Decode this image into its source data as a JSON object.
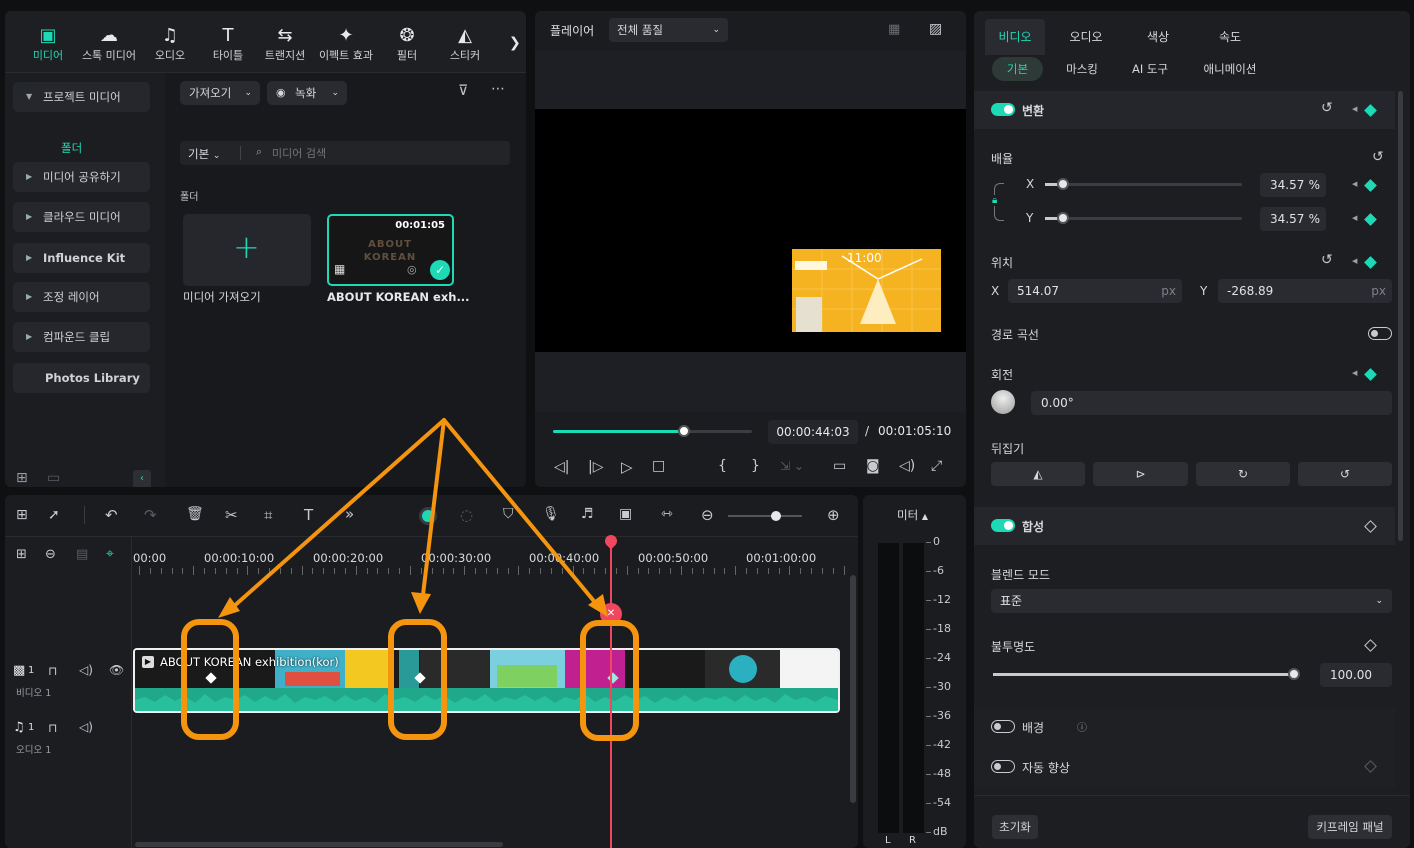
{
  "media_panel": {
    "tabs": [
      {
        "label": "미디어",
        "icon": "media-icon"
      },
      {
        "label": "스톡 미디어",
        "icon": "cloud-icon"
      },
      {
        "label": "오디오",
        "icon": "music-note-icon"
      },
      {
        "label": "타이틀",
        "icon": "text-t-icon"
      },
      {
        "label": "트랜지션",
        "icon": "transition-icon"
      },
      {
        "label": "이펙트 효과",
        "icon": "sparkle-icon"
      },
      {
        "label": "필터",
        "icon": "filter-icon"
      },
      {
        "label": "스티커",
        "icon": "sticker-icon"
      }
    ],
    "more_tabs": "❯",
    "sidebar": {
      "project_media": "프로젝트 미디어",
      "folder": "폴더",
      "items": [
        "미디어 공유하기",
        "클라우드 미디어",
        "Influence Kit",
        "조정 레이어",
        "컴파운드 클립"
      ],
      "photos_library": "Photos Library"
    },
    "import_dropdown": "가져오기",
    "record_dropdown": "녹화",
    "view_dropdown": "기본",
    "search_placeholder": "미디어 검색",
    "folder_heading": "폴더",
    "import_tile_label": "미디어 가져오기",
    "clip": {
      "duration": "00:01:05",
      "name": "ABOUT KOREAN exh...",
      "thumb_text": "ABOUT KOREAN"
    }
  },
  "player": {
    "label": "플레이어",
    "quality": "전체 품질",
    "current_time": "00:00:44:03",
    "separator": "/",
    "total_time": "00:01:05:10",
    "progress": 0.66,
    "preview_text": "11:00"
  },
  "properties": {
    "tabs": [
      "비디오",
      "오디오",
      "색상",
      "속도"
    ],
    "subtabs": [
      "기본",
      "마스킹",
      "AI 도구",
      "애니메이션"
    ],
    "transform": "변환",
    "scale": {
      "label": "배율",
      "x_label": "X",
      "y_label": "Y",
      "x": "34.57",
      "y": "34.57",
      "unit": "%",
      "level": 0.09
    },
    "position": {
      "label": "위치",
      "x_label": "X",
      "y_label": "Y",
      "x": "514.07",
      "y": "-268.89",
      "unit": "px"
    },
    "path_curve": "경로 곡선",
    "rotation": {
      "label": "회전",
      "value": "0.00°"
    },
    "flip": "뒤집기",
    "composite": "합성",
    "blend_mode": {
      "label": "블렌드 모드",
      "value": "표준"
    },
    "opacity": {
      "label": "불투명도",
      "value": "100.00",
      "level": 1.0
    },
    "background": "배경",
    "auto_enhance": "자동 향상",
    "reset": "초기화",
    "keyframe_panel": "키프레임 패널"
  },
  "timeline": {
    "ruler": [
      "00:00",
      "00:00:10:00",
      "00:00:20:00",
      "00:00:30:00",
      "00:00:40:00",
      "00:00:50:00",
      "00:01:00:00"
    ],
    "video_track": "비디오 1",
    "audio_track": "오디오 1",
    "video_num": "1",
    "audio_num": "1",
    "clip_title": "ABOUT KOREAN exhibition(kor)",
    "zoom_level": 0.65
  },
  "meter": {
    "label": "미터",
    "scale": [
      "0",
      "-6",
      "-12",
      "-18",
      "-24",
      "-30",
      "-36",
      "-42",
      "-48",
      "-54",
      "dB"
    ],
    "channels": [
      "L",
      "R"
    ]
  },
  "colors": {
    "accent": "#1ed9b5",
    "annotation": "#f5940e",
    "playhead": "#f0475f"
  }
}
